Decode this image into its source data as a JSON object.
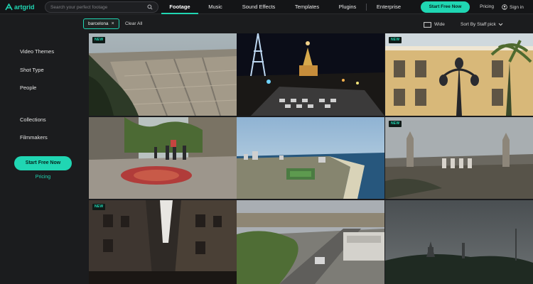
{
  "brand": {
    "name": "artgrid",
    "accent": "#20d6b3"
  },
  "search": {
    "placeholder": "Search your perfect footage",
    "value": ""
  },
  "nav": {
    "items": [
      {
        "label": "Footage",
        "active": true
      },
      {
        "label": "Music",
        "active": false
      },
      {
        "label": "Sound Effects",
        "active": false
      },
      {
        "label": "Templates",
        "active": false
      },
      {
        "label": "Plugins",
        "active": false
      },
      {
        "label": "Enterprise",
        "active": false
      }
    ],
    "cta": "Start Free Now",
    "pricing": "Pricing",
    "signin": "Sign in"
  },
  "filters": {
    "chip": "barcelona",
    "clear_all": "Clear All",
    "view": "Wide",
    "sort": "Sort By Staff pick"
  },
  "sidebar": {
    "items": [
      "Video Themes",
      "Shot Type",
      "People",
      "Collections",
      "Filmmakers"
    ],
    "cta": "Start Free Now",
    "pricing": "Pricing"
  },
  "grid": {
    "badge_label": "NEW",
    "tiles": [
      {
        "scene": "city-overview",
        "new": true
      },
      {
        "scene": "tibidabo-night",
        "new": false
      },
      {
        "scene": "facade-lamp",
        "new": true
      },
      {
        "scene": "rambla-mosaic",
        "new": false
      },
      {
        "scene": "coast-aerial",
        "new": false
      },
      {
        "scene": "montjuic-view",
        "new": true
      },
      {
        "scene": "narrow-street",
        "new": true
      },
      {
        "scene": "street-aerial",
        "new": false
      },
      {
        "scene": "stormy-hill",
        "new": false
      }
    ]
  }
}
